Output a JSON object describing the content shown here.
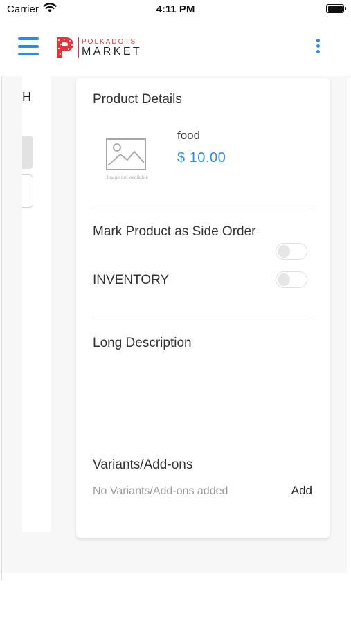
{
  "status_bar": {
    "carrier": "Carrier",
    "time": "4:11 PM"
  },
  "header": {
    "logo_top": "POLKADOTS",
    "logo_bottom": "MARKET",
    "accent_color": "#2f89e6",
    "brand_color": "#e5343d"
  },
  "left_panel": {
    "partial_text": "H"
  },
  "product": {
    "section_title": "Product Details",
    "image_caption": "Image not available",
    "name": "food",
    "price": "$ 10.00"
  },
  "options": {
    "side_order_label": "Mark Product as Side Order",
    "side_order_enabled": false,
    "inventory_label": "INVENTORY",
    "inventory_enabled": false
  },
  "description": {
    "label": "Long Description"
  },
  "variants": {
    "label": "Variants/Add-ons",
    "empty_text": "No Variants/Add-ons added",
    "add_label": "Add"
  }
}
